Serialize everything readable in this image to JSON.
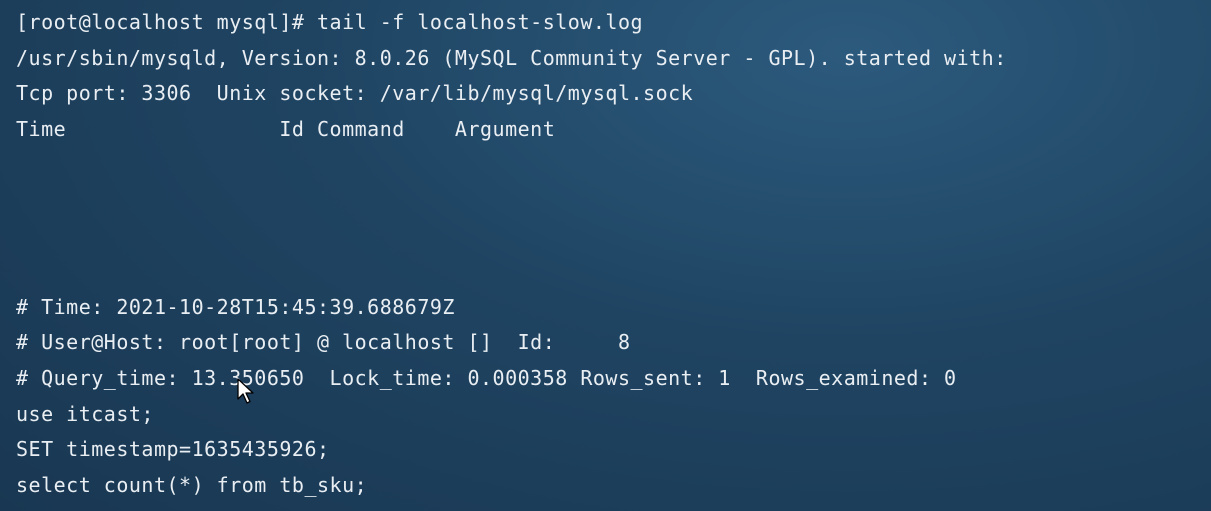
{
  "terminal": {
    "lines": [
      "[root@localhost mysql]# tail -f localhost-slow.log",
      "/usr/sbin/mysqld, Version: 8.0.26 (MySQL Community Server - GPL). started with:",
      "Tcp port: 3306  Unix socket: /var/lib/mysql/mysql.sock",
      "Time                 Id Command    Argument",
      "",
      "",
      "",
      "",
      "# Time: 2021-10-28T15:45:39.688679Z",
      "# User@Host: root[root] @ localhost []  Id:     8",
      "# Query_time: 13.350650  Lock_time: 0.000358 Rows_sent: 1  Rows_examined: 0",
      "use itcast;",
      "SET timestamp=1635435926;",
      "select count(*) from tb_sku;"
    ]
  },
  "colors": {
    "text": "#e9eef3",
    "background": "#1f4462"
  },
  "icons": {
    "cursor": "mouse-pointer-icon"
  }
}
